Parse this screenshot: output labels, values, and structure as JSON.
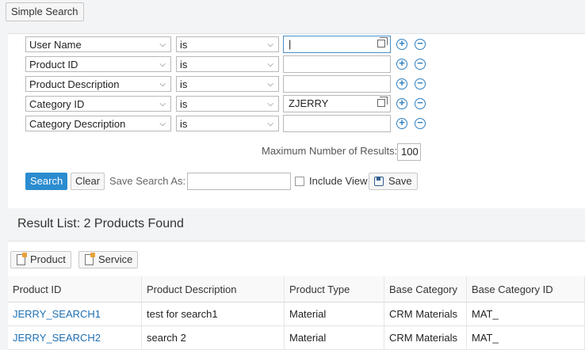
{
  "toolbar": {
    "simple_search_label": "Simple Search"
  },
  "criteria": {
    "rows": [
      {
        "field": "User Name",
        "operator": "is",
        "value": "|",
        "has_value_help": true
      },
      {
        "field": "Product ID",
        "operator": "is",
        "value": "",
        "has_value_help": false
      },
      {
        "field": "Product Description",
        "operator": "is",
        "value": "",
        "has_value_help": false
      },
      {
        "field": "Category ID",
        "operator": "is",
        "value": "ZJERRY",
        "has_value_help": true
      },
      {
        "field": "Category Description",
        "operator": "is",
        "value": "",
        "has_value_help": false
      }
    ],
    "max_results_label": "Maximum Number of Results:",
    "max_results_value": "100"
  },
  "actions": {
    "search_label": "Search",
    "clear_label": "Clear",
    "save_search_as_label": "Save Search As:",
    "save_search_as_value": "",
    "include_view_label": "Include View",
    "save_label": "Save"
  },
  "results": {
    "title": "Result List: 2 Products Found",
    "product_button": "Product",
    "service_button": "Service",
    "columns": [
      "Product ID",
      "Product Description",
      "Product Type",
      "Base Category",
      "Base Category ID"
    ],
    "rows": [
      [
        "JERRY_SEARCH1",
        "test for search1",
        "Material",
        "CRM Materials",
        "MAT_"
      ],
      [
        "JERRY_SEARCH2",
        "search 2",
        "Material",
        "CRM Materials",
        "MAT_"
      ]
    ]
  },
  "colors": {
    "accent": "#2b8cd0",
    "link": "#1f6fb2"
  },
  "icons": [
    "value-help-icon",
    "add-row-icon",
    "remove-row-icon",
    "save-icon",
    "document-icon",
    "chevron-down-icon"
  ]
}
